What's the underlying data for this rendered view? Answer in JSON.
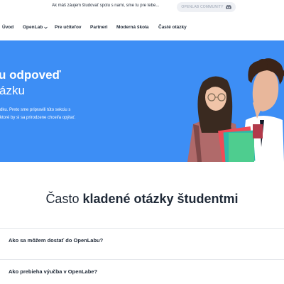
{
  "announcement": {
    "text": "Ak máš záujem študovať spolu s nami, sme tu pre tebe...",
    "community_label": "OPENLAB COMMUNITY",
    "community_icon": "discord-icon"
  },
  "nav": {
    "items": [
      "Úvod",
      "OpenLab",
      "Pre učiteľov",
      "Partneri",
      "Moderná škola",
      "Časté otázky"
    ],
    "dropdown_icon": "chevron-down-icon"
  },
  "hero": {
    "title_line1": "u odpoveď",
    "title_line2": "ázku",
    "desc_line1": "dku. Preto sme pripravili túto sekciu s",
    "desc_line2": "ktoré by si sa prirodzene chcel/a opýtať.",
    "background": "#3d8ef5"
  },
  "faq": {
    "title_normal": "Často",
    "title_bold": "kladené otázky študentmi",
    "questions": [
      "Ako sa môžem dostať do OpenLabu?",
      "Ako prebieha výučba v OpenLabe?"
    ]
  }
}
